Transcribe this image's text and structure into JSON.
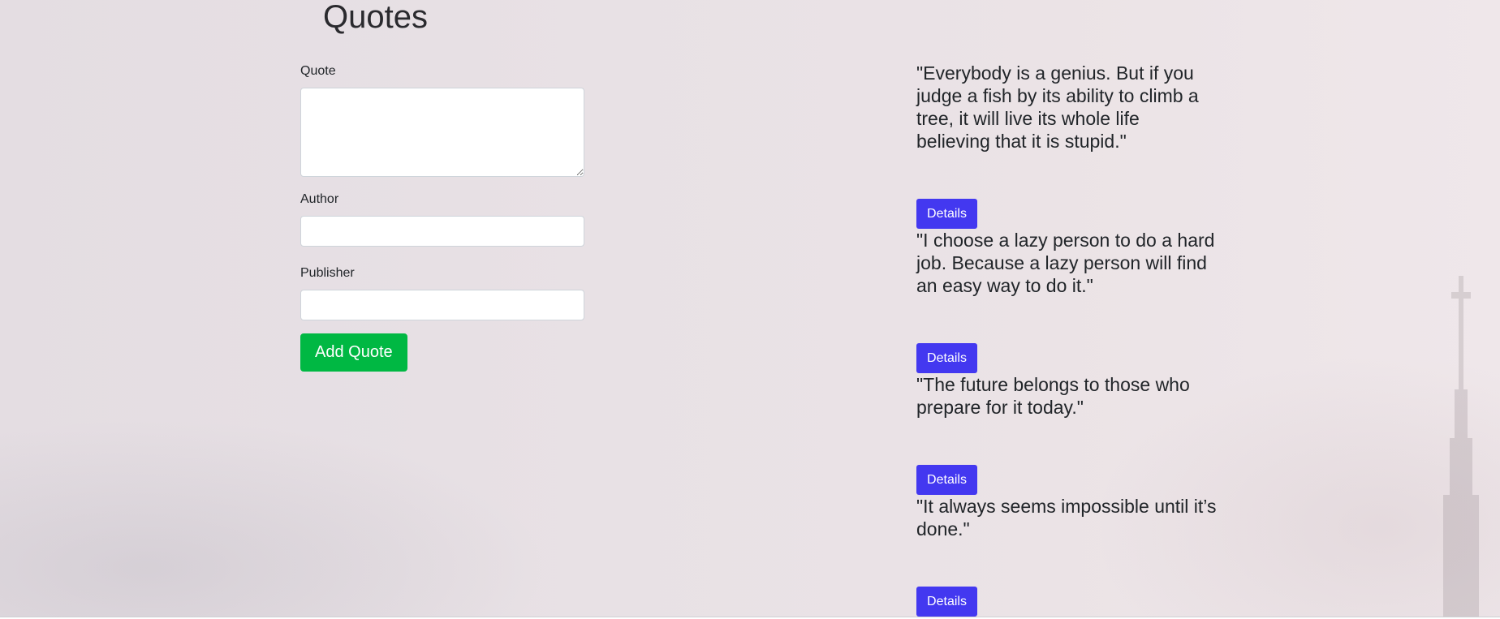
{
  "header": {
    "title": "Quotes"
  },
  "form": {
    "quote_label": "Quote",
    "quote_value": "",
    "author_label": "Author",
    "author_value": "",
    "publisher_label": "Publisher",
    "publisher_value": "",
    "submit_label": "Add Quote"
  },
  "quotes": [
    {
      "text": "\"Everybody is a genius. But if you judge a fish by its ability to climb a tree, it will live its whole life believing that it is stupid.\"",
      "details_label": "Details"
    },
    {
      "text": "\"I choose a lazy person to do a hard job. Because a lazy person will find an easy way to do it.\"",
      "details_label": "Details"
    },
    {
      "text": "\"The future belongs to those who prepare for it today.\"",
      "details_label": "Details"
    },
    {
      "text": "\"It always seems impossible until it’s done.\"",
      "details_label": "Details"
    }
  ],
  "colors": {
    "add_button": "#00b843",
    "details_button": "#4338f0",
    "background": "#e8e1e5"
  },
  "icons": {
    "textarea_resize": "resize-handle-icon"
  }
}
